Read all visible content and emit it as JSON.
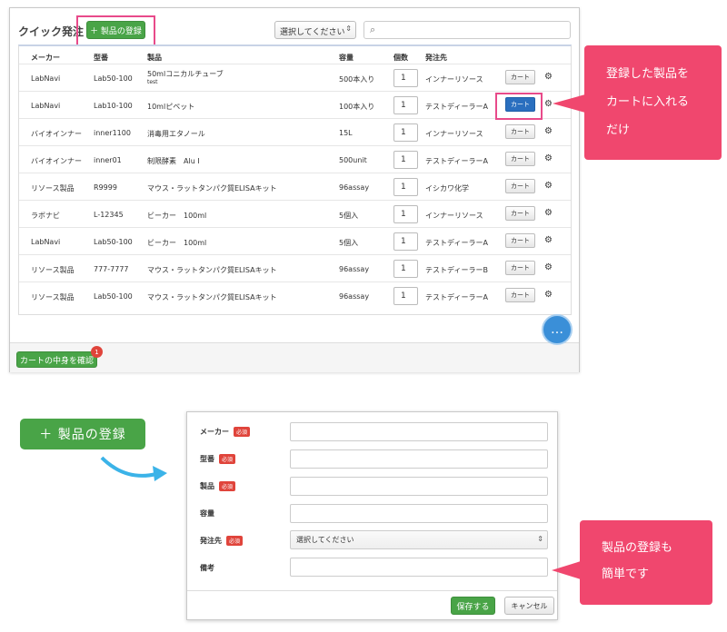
{
  "panel": {
    "title": "クイック発注",
    "add_button": "＋ 製品の登録",
    "select_value": "選択してください",
    "search_icon": "search-icon",
    "columns": [
      "メーカー",
      "型番",
      "製品",
      "容量",
      "個数",
      "発注先"
    ],
    "rows": [
      {
        "maker": "LabNavi",
        "model": "Lab50-100",
        "product": "50mlコニカルチューブ",
        "sub": "test",
        "volume": "500本入り",
        "qty": "1",
        "vendor": "インナーリソース",
        "cart": "カート"
      },
      {
        "maker": "LabNavi",
        "model": "Lab10-100",
        "product": "10mlピペット",
        "sub": "",
        "volume": "100本入り",
        "qty": "1",
        "vendor": "テストディーラーA",
        "cart": "カート"
      },
      {
        "maker": "バイオインナー",
        "model": "inner1100",
        "product": "消毒用エタノール",
        "sub": "",
        "volume": "15L",
        "qty": "1",
        "vendor": "インナーリソース",
        "cart": "カート"
      },
      {
        "maker": "バイオインナー",
        "model": "inner01",
        "product": "制限酵素　Alu I",
        "sub": "",
        "volume": "500unit",
        "qty": "1",
        "vendor": "テストディーラーA",
        "cart": "カート"
      },
      {
        "maker": "リソース製品",
        "model": "R9999",
        "product": "マウス・ラットタンパク質ELISAキット",
        "sub": "",
        "volume": "96assay",
        "qty": "1",
        "vendor": "イシカワ化学",
        "cart": "カート"
      },
      {
        "maker": "ラボナビ",
        "model": "L-12345",
        "product": "ビーカー　100ml",
        "sub": "",
        "volume": "5個入",
        "qty": "1",
        "vendor": "インナーリソース",
        "cart": "カート"
      },
      {
        "maker": "LabNavi",
        "model": "Lab50-100",
        "product": "ビーカー　100ml",
        "sub": "",
        "volume": "5個入",
        "qty": "1",
        "vendor": "テストディーラーA",
        "cart": "カート"
      },
      {
        "maker": "リソース製品",
        "model": "777-7777",
        "product": "マウス・ラットタンパク質ELISAキット",
        "sub": "",
        "volume": "96assay",
        "qty": "1",
        "vendor": "テストディーラーB",
        "cart": "カート"
      },
      {
        "maker": "リソース製品",
        "model": "Lab50-100",
        "product": "マウス・ラットタンパク質ELISAキット",
        "sub": "",
        "volume": "96assay",
        "qty": "1",
        "vendor": "テストディーラーA",
        "cart": "カート"
      }
    ],
    "checkout_button": "カートの中身を確認",
    "cart_count": "1"
  },
  "callout1": {
    "lines": [
      "登録した製品を",
      "カートに入れる",
      "だけ"
    ]
  },
  "big_button": "＋ 製品の登録",
  "form": {
    "fields": [
      {
        "label": "メーカー",
        "required": "必須"
      },
      {
        "label": "型番",
        "required": "必須"
      },
      {
        "label": "製品",
        "required": "必須"
      },
      {
        "label": "容量",
        "required": ""
      },
      {
        "label": "発注先",
        "required": "必須"
      },
      {
        "label": "備考",
        "required": ""
      }
    ],
    "vendor_select": "選択してください",
    "save": "保存する",
    "cancel": "キャンセル"
  },
  "callout2": {
    "lines": [
      "製品の登録も",
      "簡単です"
    ]
  },
  "colors": {
    "green": "#49a447",
    "pink": "#f0476e",
    "blue": "#2a6fbf"
  }
}
